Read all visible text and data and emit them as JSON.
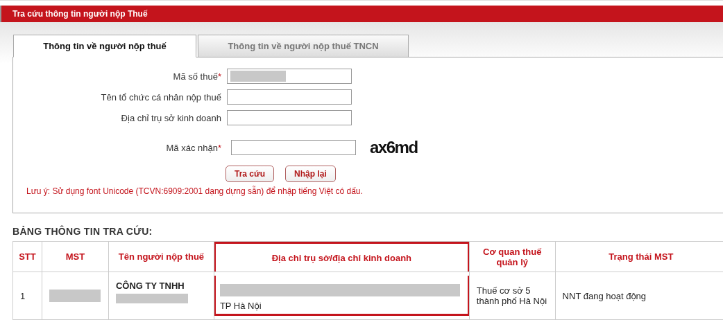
{
  "title": "Tra cứu thông tin người nộp Thuế",
  "tabs": [
    {
      "label": "Thông tin về người nộp thuế",
      "selected": true
    },
    {
      "label": "Thông tin về người nộp thuế TNCN",
      "selected": false
    }
  ],
  "required_mark": "*",
  "fields": [
    {
      "label": "Mã số thuế",
      "required": true,
      "redacted": true,
      "kind": "text"
    },
    {
      "label": "Tên tổ chức cá nhân nộp thuế",
      "required": false,
      "redacted": false,
      "kind": "text"
    },
    {
      "label": "Địa chỉ trụ sở kinh doanh",
      "required": false,
      "redacted": false,
      "kind": "text"
    },
    {
      "label": "Mã xác nhận",
      "required": true,
      "redacted": false,
      "kind": "captcha",
      "captcha": "ax6md"
    }
  ],
  "buttons": [
    "Tra cứu",
    "Nhập lại"
  ],
  "note": "Lưu ý: Sử dụng font Unicode (TCVN:6909:2001 dạng dựng sẵn) để nhập tiếng Việt có dấu.",
  "table": {
    "title": "BẢNG THÔNG TIN TRA CỨU:",
    "columns": [
      {
        "label": "STT",
        "highlighted": false
      },
      {
        "label": "MST",
        "highlighted": false
      },
      {
        "label": "Tên người nộp thuế",
        "highlighted": false
      },
      {
        "label": "Địa chỉ trụ sở/địa chỉ kinh doanh",
        "highlighted": true
      },
      {
        "label": "Cơ quan thuế quản lý",
        "highlighted": false
      },
      {
        "label": "Trạng thái MST",
        "highlighted": false
      }
    ],
    "rows": [
      {
        "cells": [
          {
            "text": "1",
            "redacted_before": false,
            "redacted_after": false
          },
          {
            "redacted_before": true,
            "redacted_after": false
          },
          {
            "text": "CÔNG TY TNHH",
            "redacted_before": false,
            "redacted_after": true
          },
          {
            "text": "TP Hà Nội",
            "redacted_before": true,
            "redacted_after": false
          },
          {
            "text": "Thuế cơ sở 5 thành phố Hà Nội",
            "redacted_before": false,
            "redacted_after": false
          },
          {
            "text": "NNT đang hoạt động",
            "redacted_before": false,
            "redacted_after": false
          }
        ]
      }
    ]
  }
}
